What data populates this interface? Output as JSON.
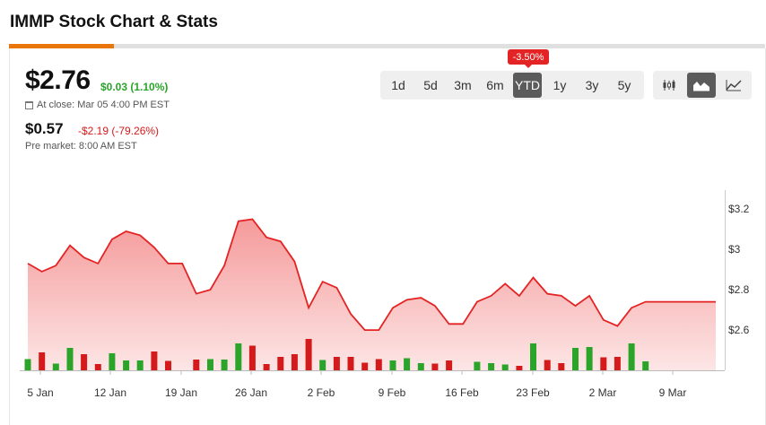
{
  "header": {
    "title": "IMMP Stock Chart & Stats"
  },
  "quote": {
    "price": "$2.76",
    "change": "$0.03 (1.10%)",
    "close_info": "At close: Mar 05 4:00 PM EST",
    "pre_price": "$0.57",
    "pre_change": "-$2.19 (-79.26%)",
    "pre_label": "Pre market: 8:00 AM EST"
  },
  "range": {
    "buttons": [
      "1d",
      "5d",
      "3m",
      "6m",
      "YTD",
      "1y",
      "3y",
      "5y"
    ],
    "active": "YTD",
    "badge": "-3.50%"
  },
  "chart_types": [
    "candlestick-icon",
    "area-chart-icon",
    "line-chart-icon"
  ],
  "colors": {
    "accent": "#e8760a",
    "up": "#2aa52a",
    "down": "#d41a1a",
    "line": "#e42424",
    "fill": "#f59a9a"
  },
  "chart_data": {
    "type": "area",
    "x_labels": [
      "5 Jan",
      "12 Jan",
      "19 Jan",
      "26 Jan",
      "2 Feb",
      "9 Feb",
      "16 Feb",
      "23 Feb",
      "2 Mar",
      "9 Mar"
    ],
    "y_ticks": [
      "$3.2",
      "$3",
      "$2.8",
      "$2.6"
    ],
    "ylim": [
      2.4,
      3.25
    ],
    "grid": false,
    "price": [
      2.93,
      2.89,
      2.92,
      3.02,
      2.96,
      2.93,
      3.05,
      3.09,
      3.07,
      3.01,
      2.93,
      2.93,
      2.78,
      2.8,
      2.92,
      3.14,
      3.15,
      3.06,
      3.04,
      2.94,
      2.71,
      2.84,
      2.81,
      2.68,
      2.6,
      2.6,
      2.71,
      2.75,
      2.76,
      2.72,
      2.63,
      2.63,
      2.74,
      2.77,
      2.83,
      2.77,
      2.86,
      2.78,
      2.77,
      2.72,
      2.77,
      2.65,
      2.62,
      2.71,
      2.74,
      2.74,
      2.74,
      2.74,
      2.74,
      2.74
    ],
    "volume": [
      {
        "x": 0,
        "v": 0.25,
        "d": "up"
      },
      {
        "x": 1,
        "v": 0.4,
        "d": "down"
      },
      {
        "x": 2,
        "v": 0.15,
        "d": "up"
      },
      {
        "x": 3,
        "v": 0.5,
        "d": "up"
      },
      {
        "x": 4,
        "v": 0.36,
        "d": "down"
      },
      {
        "x": 5,
        "v": 0.14,
        "d": "down"
      },
      {
        "x": 6,
        "v": 0.38,
        "d": "up"
      },
      {
        "x": 7,
        "v": 0.22,
        "d": "up"
      },
      {
        "x": 8,
        "v": 0.22,
        "d": "up"
      },
      {
        "x": 9,
        "v": 0.42,
        "d": "down"
      },
      {
        "x": 10,
        "v": 0.21,
        "d": "down"
      },
      {
        "x": 12,
        "v": 0.24,
        "d": "down"
      },
      {
        "x": 13,
        "v": 0.25,
        "d": "up"
      },
      {
        "x": 14,
        "v": 0.24,
        "d": "up"
      },
      {
        "x": 15,
        "v": 0.6,
        "d": "up"
      },
      {
        "x": 16,
        "v": 0.55,
        "d": "down"
      },
      {
        "x": 17,
        "v": 0.14,
        "d": "down"
      },
      {
        "x": 18,
        "v": 0.3,
        "d": "down"
      },
      {
        "x": 19,
        "v": 0.36,
        "d": "down"
      },
      {
        "x": 20,
        "v": 0.7,
        "d": "down"
      },
      {
        "x": 21,
        "v": 0.23,
        "d": "up"
      },
      {
        "x": 22,
        "v": 0.3,
        "d": "down"
      },
      {
        "x": 23,
        "v": 0.3,
        "d": "down"
      },
      {
        "x": 24,
        "v": 0.17,
        "d": "down"
      },
      {
        "x": 25,
        "v": 0.25,
        "d": "down"
      },
      {
        "x": 26,
        "v": 0.22,
        "d": "up"
      },
      {
        "x": 27,
        "v": 0.27,
        "d": "up"
      },
      {
        "x": 28,
        "v": 0.16,
        "d": "up"
      },
      {
        "x": 29,
        "v": 0.15,
        "d": "down"
      },
      {
        "x": 30,
        "v": 0.22,
        "d": "down"
      },
      {
        "x": 32,
        "v": 0.19,
        "d": "up"
      },
      {
        "x": 33,
        "v": 0.16,
        "d": "up"
      },
      {
        "x": 34,
        "v": 0.13,
        "d": "up"
      },
      {
        "x": 35,
        "v": 0.1,
        "d": "down"
      },
      {
        "x": 36,
        "v": 0.6,
        "d": "up"
      },
      {
        "x": 37,
        "v": 0.23,
        "d": "down"
      },
      {
        "x": 38,
        "v": 0.16,
        "d": "down"
      },
      {
        "x": 39,
        "v": 0.5,
        "d": "up"
      },
      {
        "x": 40,
        "v": 0.52,
        "d": "up"
      },
      {
        "x": 41,
        "v": 0.29,
        "d": "down"
      },
      {
        "x": 42,
        "v": 0.3,
        "d": "down"
      },
      {
        "x": 43,
        "v": 0.6,
        "d": "up"
      },
      {
        "x": 44,
        "v": 0.2,
        "d": "up"
      }
    ]
  }
}
